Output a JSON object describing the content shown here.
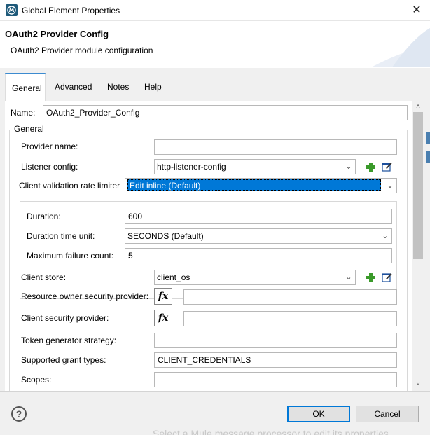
{
  "window": {
    "title": "Global Element Properties",
    "close_glyph": "✕"
  },
  "header": {
    "title": "OAuth2 Provider Config",
    "subtitle": "OAuth2 Provider module configuration"
  },
  "tabs": [
    {
      "label": "General",
      "active": true
    },
    {
      "label": "Advanced",
      "active": false
    },
    {
      "label": "Notes",
      "active": false
    },
    {
      "label": "Help",
      "active": false
    }
  ],
  "form": {
    "name_label": "Name:",
    "name_value": "OAuth2_Provider_Config",
    "group_title": "General",
    "provider_name_label": "Provider name:",
    "provider_name_value": "",
    "listener_config_label": "Listener config:",
    "listener_config_value": "http-listener-config",
    "rate_limiter_label": "Client validation rate limiter",
    "rate_limiter_value": "Edit inline (Default)",
    "duration_label": "Duration:",
    "duration_value": "600",
    "duration_unit_label": "Duration time unit:",
    "duration_unit_value": "SECONDS (Default)",
    "max_failure_label": "Maximum failure count:",
    "max_failure_value": "5",
    "client_store_label": "Client store:",
    "client_store_value": "client_os",
    "resource_owner_label": "Resource owner security provider:",
    "resource_owner_value": "",
    "client_security_label": "Client security provider:",
    "client_security_value": "",
    "token_generator_label": "Token generator strategy:",
    "token_generator_value": "",
    "grant_types_label": "Supported grant types:",
    "grant_types_value": "CLIENT_CREDENTIALS",
    "scopes_label": "Scopes:",
    "scopes_value": "",
    "fx_glyph": "fx"
  },
  "footer": {
    "help_glyph": "?",
    "ok_label": "OK",
    "cancel_label": "Cancel",
    "background_text": "Select a Mule message processor to edit its properties"
  },
  "icons": {
    "app": "mule-app-icon",
    "add": "plus-icon",
    "edit": "edit-icon",
    "help": "help-icon",
    "dropdown": "chevron-down-icon"
  },
  "colors": {
    "accent": "#0078d7",
    "tab_accent": "#3c8bd0",
    "plus_green": "#3a9a2a"
  }
}
